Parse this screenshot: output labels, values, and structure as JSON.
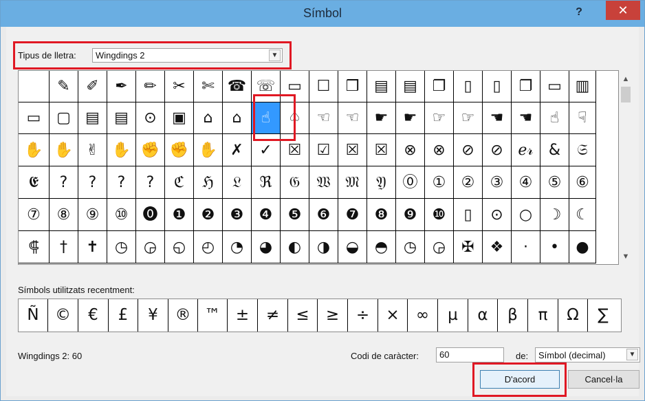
{
  "window": {
    "title": "Símbol",
    "help_label": "?",
    "close_label": "✕"
  },
  "font": {
    "label": "Tipus de lletra:",
    "value": "Wingdings 2"
  },
  "grid": {
    "rows": [
      [
        "",
        "✎",
        "✐",
        "✒",
        "✏",
        "✂",
        "✄",
        "☎",
        "☏",
        "▭",
        "☐",
        "❒",
        "▤",
        "▤",
        "❐",
        "▯",
        "▯",
        "❐",
        "▭",
        "▥"
      ],
      [
        "▭",
        "▢",
        "▤",
        "▤",
        "⊙",
        "▣",
        "⌂",
        "⌂",
        "☝",
        "♤",
        "☜",
        "☜",
        "☛",
        "☛",
        "☞",
        "☞",
        "☚",
        "☚",
        "☝",
        "☟"
      ],
      [
        "✋",
        "✋",
        "✌",
        "✋",
        "✊",
        "✊",
        "✋",
        "✗",
        "✓",
        "☒",
        "☑",
        "☒",
        "☒",
        "⊗",
        "⊗",
        "⊘",
        "⊘",
        "ℯ𝓇",
        "&",
        "𝔖"
      ],
      [
        "𝕰",
        "?",
        "?",
        "?",
        "?",
        "ℭ",
        "ℌ",
        "𝔏",
        "ℜ",
        "𝔊",
        "𝔚",
        "𝔐",
        "𝔜",
        "⓪",
        "①",
        "②",
        "③",
        "④",
        "⑤",
        "⑥"
      ],
      [
        "⑦",
        "⑧",
        "⑨",
        "⑩",
        "⓿",
        "❶",
        "❷",
        "❸",
        "❹",
        "❺",
        "❻",
        "❼",
        "❽",
        "❾",
        "❿",
        "▯",
        "⊙",
        "○",
        "☽",
        "☾"
      ],
      [
        "⸿",
        "†",
        "✝",
        "◷",
        "◶",
        "◵",
        "◴",
        "◔",
        "◕",
        "◐",
        "◑",
        "◒",
        "◓",
        "◷",
        "◶",
        "✠",
        "❖",
        "·",
        "•",
        "●"
      ]
    ]
  },
  "recent": {
    "label": "Símbols utilitzats recentment:",
    "symbols": [
      "Ñ",
      "©",
      "€",
      "£",
      "¥",
      "®",
      "™",
      "±",
      "≠",
      "≤",
      "≥",
      "÷",
      "×",
      "∞",
      "µ",
      "α",
      "β",
      "π",
      "Ω",
      "∑"
    ]
  },
  "footer": {
    "char_name": "Wingdings 2: 60",
    "code_label": "Codi de caràcter:",
    "code_value": "60",
    "from_label": "de:",
    "from_value": "Símbol (decimal)",
    "ok_label": "D'acord",
    "cancel_label": "Cancel·la"
  },
  "colors": {
    "highlight": "#e01823",
    "selection": "#3399ff",
    "close": "#c8413a",
    "titlebar": "#6aaee2"
  },
  "selected_symbol": "☝"
}
